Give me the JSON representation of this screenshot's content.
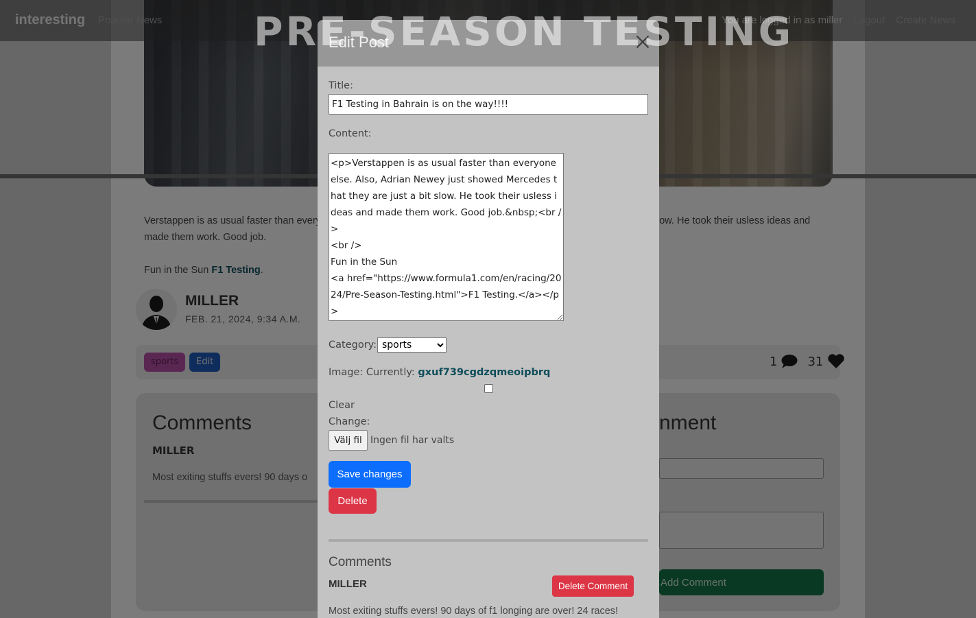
{
  "navbar": {
    "brand": "interesting",
    "popular": "Popular News",
    "logged_in_text": "You are logged in as miller",
    "logout": "Logout",
    "create": "Create News"
  },
  "hero": {
    "title": "PRE-SEASON TESTING"
  },
  "article": {
    "paragraph_1": "Verstappen is as usual faster than everyone else. Also, Adrian Newey just showed Mercedes that they are just a bit slow. He took their usless ideas and made them work. Good job.",
    "paragraph_2_prefix": "Fun in the Sun ",
    "link_text": "F1 Testing",
    "paragraph_2_suffix": "."
  },
  "author": {
    "name": "MILLER",
    "date": "FEB. 21, 2024, 9:34 A.M."
  },
  "tags": {
    "category": "sports",
    "edit": "Edit"
  },
  "stats": {
    "comments": "1",
    "likes": "31"
  },
  "comments_section": {
    "title": "Comments",
    "author": "MILLER",
    "body": "Most exiting stuffs evers! 90 days o"
  },
  "add_comment": {
    "title": "nment",
    "button": "Add Comment"
  },
  "modal": {
    "title": "Edit Post",
    "title_label": "Title:",
    "title_value": "F1 Testing in Bahrain is on the way!!!!",
    "content_label": "Content:",
    "content_value": "<p>Verstappen is as usual faster than everyone else. Also, Adrian Newey just showed Mercedes that they are just a bit slow. He took their usless ideas and made them work. Good job.&nbsp;<br />\n<br />\nFun in the Sun\n<a href=\"https://www.formula1.com/en/racing/2024/Pre-Season-Testing.html\">F1 Testing.</a></p>",
    "category_label": "Category:",
    "category_value": "sports",
    "image_label": "Image: Currently: ",
    "image_current": "gxuf739cgdzqmeoipbrq",
    "clear_label": "Clear",
    "change_label": "Change:",
    "file_button": "Välj fil",
    "file_status": "Ingen fil har valts",
    "save_button": "Save changes",
    "delete_button": "Delete",
    "comments_title": "Comments",
    "comment_author": "MILLER",
    "delete_comment_button": "Delete Comment",
    "comment_body": "Most exiting stuffs evers! 90 days of f1 longing are over! 24 races!"
  },
  "colors": {
    "primary": "#0d6efd",
    "danger": "#dc3545",
    "success": "#157347",
    "tag_sports": "#b54fa6",
    "link": "#0f4d5a"
  }
}
